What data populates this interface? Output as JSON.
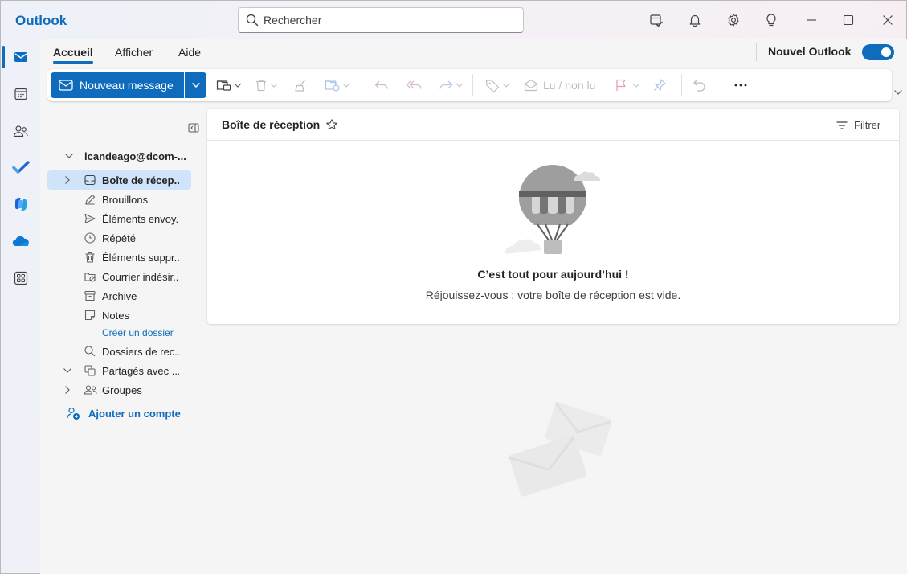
{
  "app": {
    "title": "Outlook"
  },
  "search": {
    "placeholder": "Rechercher"
  },
  "titlebar_icons": [
    "my-day-icon",
    "bell-icon",
    "gear-icon",
    "lightbulb-icon",
    "minimize-icon",
    "maximize-icon",
    "close-icon"
  ],
  "rail": {
    "items": [
      "mail-icon",
      "calendar-icon",
      "people-icon",
      "todo-icon",
      "copilot-icon",
      "onedrive-icon",
      "apps-icon"
    ],
    "active": "mail-icon"
  },
  "tabs": [
    {
      "label": "Accueil",
      "active": true
    },
    {
      "label": "Afficher",
      "active": false
    },
    {
      "label": "Aide",
      "active": false
    }
  ],
  "new_outlook": {
    "label": "Nouvel Outlook",
    "enabled": true
  },
  "ribbon": {
    "new_message": "Nouveau message",
    "read_unread": "Lu / non lu"
  },
  "folders": {
    "account": "lcandeago@dcom-...",
    "items": [
      {
        "label": "Boîte de récep...",
        "icon": "inbox-icon",
        "selected": true,
        "expandable": true
      },
      {
        "label": "Brouillons",
        "icon": "pencil-icon"
      },
      {
        "label": "Éléments envoy...",
        "icon": "send-icon"
      },
      {
        "label": "Répété",
        "icon": "clock-icon"
      },
      {
        "label": "Éléments suppr...",
        "icon": "trash-icon"
      },
      {
        "label": "Courrier indésir...",
        "icon": "junk-icon"
      },
      {
        "label": "Archive",
        "icon": "archive-icon"
      },
      {
        "label": "Notes",
        "icon": "note-icon"
      }
    ],
    "create_folder": "Créer un dossier",
    "search_folders": "Dossiers de rec...",
    "shared": "Partagés avec ...",
    "groups": "Groupes",
    "add_account": "Ajouter un compte"
  },
  "message_list": {
    "title": "Boîte de réception",
    "filter": "Filtrer",
    "empty_title": "C’est tout pour aujourd’hui !",
    "empty_subtitle": "Réjouissez-vous : votre boîte de réception est vide."
  },
  "colors": {
    "accent": "#0f6cbd",
    "selected": "#cfe4fa"
  }
}
